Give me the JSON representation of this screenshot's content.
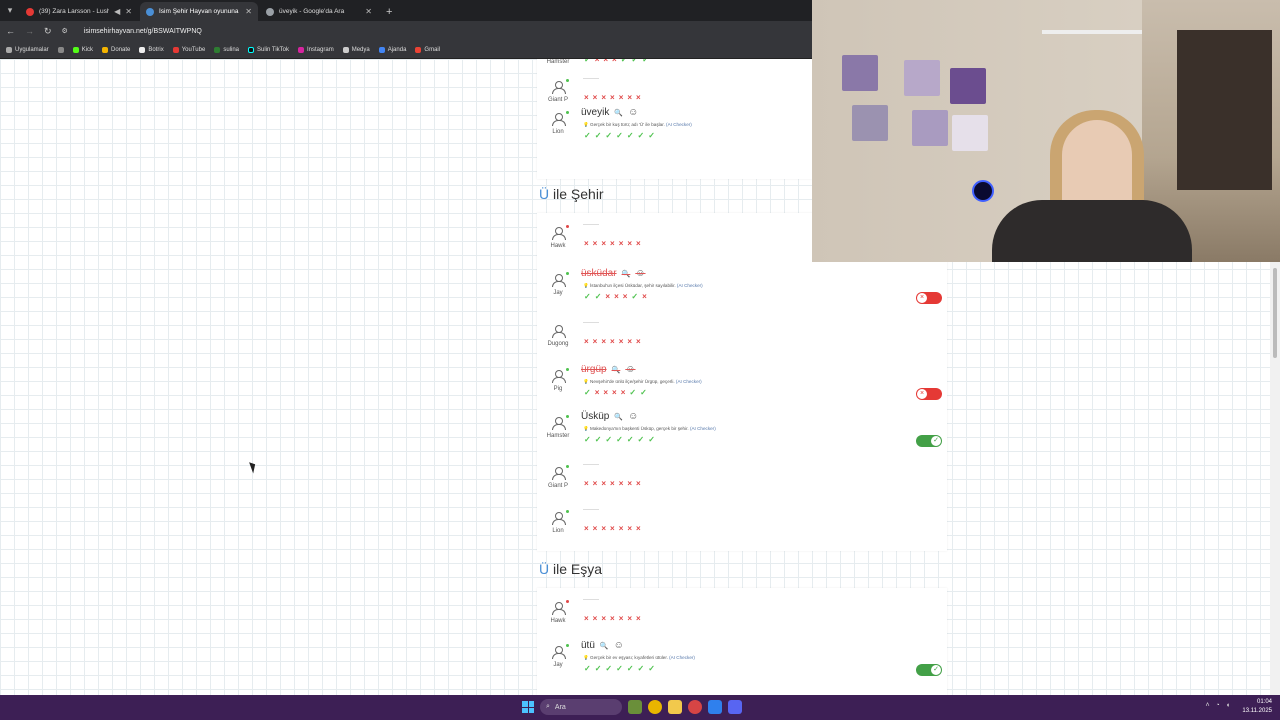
{
  "tabs": [
    {
      "title": "(39) Zara Larsson - Lush Li",
      "color": "#e53935",
      "active": false
    },
    {
      "title": "İsim Şehir Hayvan oyununa ka",
      "color": "#4a8fd6",
      "active": true
    },
    {
      "title": "üveyik - Google'da Ara",
      "color": "#9aa0a6",
      "active": false
    }
  ],
  "address": {
    "url": "isimsehirhayvan.net/g/BSWAITWPNQ"
  },
  "bookmarks": [
    "Uygulamalar",
    "Kick",
    "Donate",
    "Botrix",
    "YouTube",
    "sulina",
    "Sulin TikTok",
    "Instagram",
    "Medya",
    "Ajanda",
    "Gmail"
  ],
  "icons": {
    "back": "back-arrow-icon",
    "forward": "forward-arrow-icon",
    "reload": "reload-icon",
    "site": "site-info-icon",
    "search": "search-icon",
    "emoji": "emoji-icon",
    "check": "check-icon",
    "cross": "cross-icon",
    "person": "person-icon"
  },
  "colors": {
    "accent": "#4a8fd6",
    "ok": "#4fc24f",
    "no": "#e04848",
    "invalid": "#e53935",
    "valid": "#43a047"
  },
  "glyphs": {
    "check": "✓",
    "cross": "×",
    "toggle_off": "×",
    "toggle_on": "✓",
    "magnifier": "🔍",
    "smile": "☺",
    "bulb": "💡"
  },
  "ai_tag": "(AI Checker)",
  "top_section": {
    "rows": [
      {
        "player": "Hamster",
        "status": "green",
        "votes": [
          "ok",
          "no",
          "no",
          "no",
          "ok",
          "ok",
          "ok"
        ]
      },
      {
        "player": "Giant P",
        "status": "green",
        "answer": "",
        "votes": [
          "no",
          "no",
          "no",
          "no",
          "no",
          "no",
          "no"
        ]
      },
      {
        "player": "Lion",
        "status": "green",
        "answer": "üveyik",
        "note": "Gerçek bir kuş türü; adı 'Ü' ile başlar.",
        "votes": [
          "ok",
          "ok",
          "ok",
          "ok",
          "ok",
          "ok",
          "ok"
        ]
      }
    ]
  },
  "sections": [
    {
      "letter": "Ü",
      "title": "ile Şehir",
      "rows": [
        {
          "player": "Hawk",
          "status": "red",
          "answer": "",
          "votes": [
            "no",
            "no",
            "no",
            "no",
            "no",
            "no",
            "no"
          ]
        },
        {
          "player": "Jay",
          "status": "green",
          "answer": "üsküdar",
          "bad": true,
          "note": "İstanbul'un ilçesi Üsküdar, şehir sayılabilir.",
          "votes": [
            "ok",
            "ok",
            "no",
            "no",
            "no",
            "ok",
            "no"
          ],
          "toggle": "off"
        },
        {
          "player": "Dugong",
          "status": "none",
          "answer": "",
          "votes": [
            "no",
            "no",
            "no",
            "no",
            "no",
            "no",
            "no"
          ]
        },
        {
          "player": "Pig",
          "status": "green",
          "answer": "ürgüp",
          "bad": true,
          "note": "Nevşehir'de ünlü ilçe/şehir Ürgüp, geçerli.",
          "votes": [
            "ok",
            "no",
            "no",
            "no",
            "no",
            "ok",
            "ok"
          ],
          "toggle": "off"
        },
        {
          "player": "Hamster",
          "status": "green",
          "answer": "Üsküp",
          "note": "Makedonya'nın başkenti Üsküp, gerçek bir şehir.",
          "votes": [
            "ok",
            "ok",
            "ok",
            "ok",
            "ok",
            "ok",
            "ok"
          ],
          "toggle": "on"
        },
        {
          "player": "Giant P",
          "status": "green",
          "answer": "",
          "votes": [
            "no",
            "no",
            "no",
            "no",
            "no",
            "no",
            "no"
          ]
        },
        {
          "player": "Lion",
          "status": "green",
          "answer": "",
          "votes": [
            "no",
            "no",
            "no",
            "no",
            "no",
            "no",
            "no"
          ]
        }
      ]
    },
    {
      "letter": "Ü",
      "title": "ile Eşya",
      "rows": [
        {
          "player": "Hawk",
          "status": "red",
          "answer": "",
          "votes": [
            "no",
            "no",
            "no",
            "no",
            "no",
            "no",
            "no"
          ]
        },
        {
          "player": "Jay",
          "status": "green",
          "answer": "ütü",
          "note": "Gerçek bir ev eşyası; kıyafetleri ütüler.",
          "votes": [
            "ok",
            "ok",
            "ok",
            "ok",
            "ok",
            "ok",
            "ok"
          ],
          "toggle": "on"
        }
      ]
    }
  ],
  "taskbar": {
    "search_placeholder": "Ara",
    "time": "01:04",
    "date": "13.11.2025"
  }
}
